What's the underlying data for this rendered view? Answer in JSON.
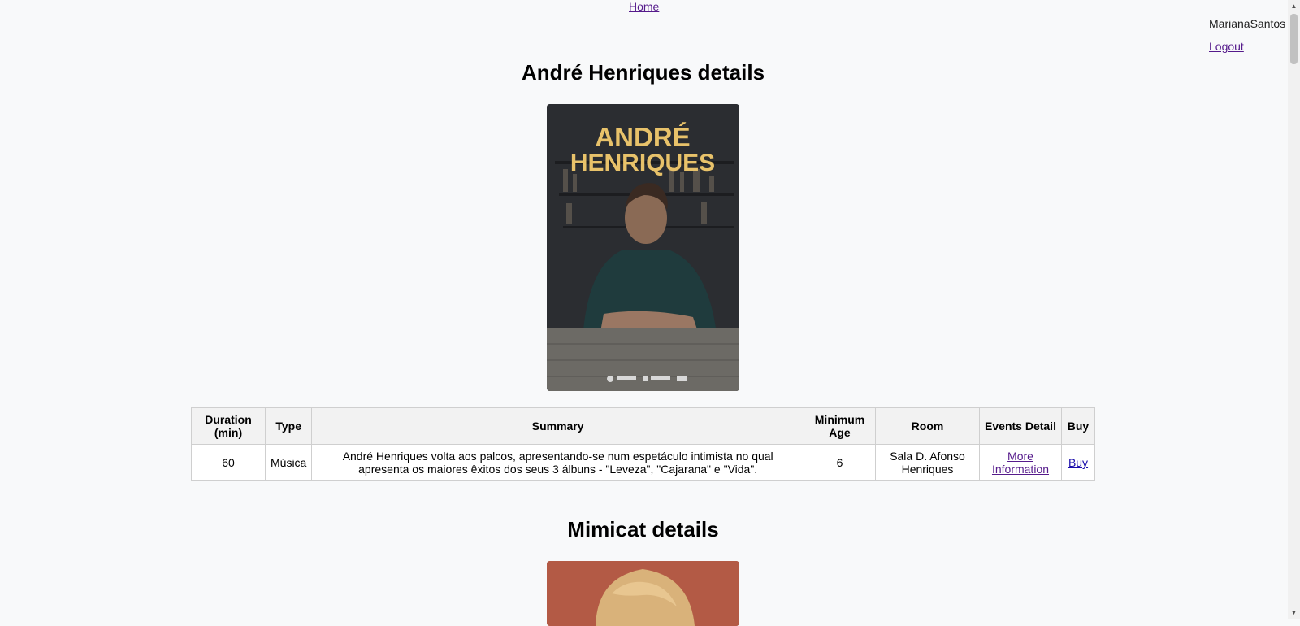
{
  "nav": {
    "home_label": "Home"
  },
  "user": {
    "username": "MarianaSantos",
    "logout_label": "Logout"
  },
  "sections": [
    {
      "title": "André Henriques details",
      "poster": {
        "title_line1": "ANDRÉ",
        "title_line2": "HENRIQUES"
      },
      "table": {
        "headers": [
          "Duration (min)",
          "Type",
          "Summary",
          "Minimum Age",
          "Room",
          "Events Detail",
          "Buy"
        ],
        "row": {
          "duration": "60",
          "type": "Música",
          "summary": "André Henriques volta aos palcos, apresentando-se num espetáculo intimista no qual apresenta os maiores êxitos dos seus 3 álbuns - \"Leveza\", \"Cajarana\" e \"Vida\".",
          "minimum_age": "6",
          "room": "Sala D. Afonso Henriques",
          "events_detail_link": "More Information",
          "buy_link": "Buy"
        }
      }
    },
    {
      "title": "Mimicat details"
    }
  ],
  "colors": {
    "page_bg": "#f8f9fa",
    "poster_title": "#e8c26a",
    "poster2_bg": "#b35a45"
  },
  "icons": {
    "scroll_up": "triangle-up",
    "scroll_down": "triangle-down"
  }
}
